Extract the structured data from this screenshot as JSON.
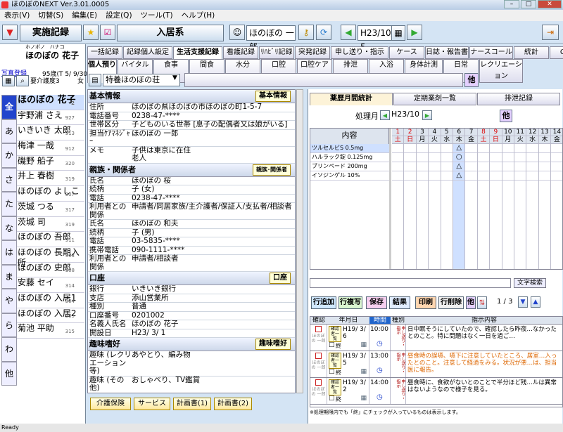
{
  "window": {
    "title": "ほのぼのNEXT  Ver.3.01.0005"
  },
  "menu": [
    "表示(V)",
    "切替(S)",
    "編集(E)",
    "設定(Q)",
    "ツール(T)",
    "ヘルプ(H)"
  ],
  "toolbar": {
    "mode_label": "実施記録",
    "category": "入居系",
    "user_name": "ほのぼの 一郎",
    "date": "H23/10/ 5"
  },
  "resident": {
    "ruby_family": "ホノボノ",
    "ruby_given": "ハナコ",
    "name": "ほのぼの 花子",
    "age_info": "95歳(T 5/ 9/30)",
    "care_level": "要介護度3",
    "sex": "女",
    "link_label": "写真登録"
  },
  "kana_tabs": [
    "全",
    "あ",
    "か",
    "さ",
    "た",
    "な",
    "は",
    "ま",
    "や",
    "ら",
    "わ",
    "他"
  ],
  "residents": [
    {
      "name": "ほのぼの 花子",
      "num": "2"
    },
    {
      "name": "宇野浦 さえ",
      "num": "927"
    },
    {
      "name": "いきいき 太郎",
      "num": "913"
    },
    {
      "name": "梅津 一哉",
      "num": "912"
    },
    {
      "name": "磯野 船子",
      "num": "320"
    },
    {
      "name": "井上 春樹",
      "num": "319"
    },
    {
      "name": "ほのぼの よしこ",
      "num": "907"
    },
    {
      "name": "茨城 つる",
      "num": "317"
    },
    {
      "name": "茨城 司",
      "num": "319"
    },
    {
      "name": "ほのぼの 吾郎",
      "num": "911"
    },
    {
      "name": "ほのぼの 長期入所",
      "num": "903"
    },
    {
      "name": "ほのぼの 史郎",
      "num": "908"
    },
    {
      "name": "安藤 セイ",
      "num": "314"
    },
    {
      "name": "ほのぼの 入居1",
      "num": "904"
    },
    {
      "name": "ほのぼの 入居2",
      "num": "905"
    },
    {
      "name": "菊池 平助",
      "num": "315"
    }
  ],
  "tabs_top": [
    "一括記録",
    "記録個人設定",
    "生活支援記録",
    "看護記録",
    "ﾘﾊﾋﾞﾘ記録",
    "突発記録",
    "申し送り・指示",
    "ケース",
    "日誌・報告書",
    "ナースコール",
    "統計",
    "CSV"
  ],
  "tabs_sub": [
    "個人預り",
    "バイタル",
    "食事",
    "間食",
    "水分",
    "口腔",
    "口腔ケア",
    "排泄",
    "入浴",
    "身体計測",
    "日常",
    "レクリエーション"
  ],
  "facility": "特養ほのぼの荘",
  "other_label": "他",
  "basic": {
    "title": "基本情報",
    "btn": "基本情報",
    "rows": [
      {
        "k": "住所",
        "v": "ほのぼの県ほのぼの市ほのぼの町1-5-7"
      },
      {
        "k": "電話番号",
        "v": "0238-47-****"
      },
      {
        "k": "世帯区分",
        "v": "子どものいる世帯 [息子の配偶者又は娘がいる]"
      },
      {
        "k": "担当ｹｱﾏﾈｼﾞｬｰ",
        "v": "ほのぼの 一郎"
      },
      {
        "k": "メモ",
        "v": "子供は東京に在住\n老人"
      }
    ]
  },
  "family": {
    "title": "親族・関係者",
    "btn": "親族･関係者",
    "rows": [
      {
        "k": "氏名",
        "v": "ほのぼの 桜"
      },
      {
        "k": "続柄",
        "v": "子 (女)"
      },
      {
        "k": "電話",
        "v": "0238-47-****"
      },
      {
        "k": "利用者との関係",
        "v": "申請者/同居家族/主介護者/保証人/支払者/相談者"
      },
      {
        "k": "氏名",
        "v": "ほのぼの 和夫"
      },
      {
        "k": "続柄",
        "v": "子 (男)"
      },
      {
        "k": "電話",
        "v": "03-5835-****"
      },
      {
        "k": "携帯電話",
        "v": "090-1111-****"
      },
      {
        "k": "利用者との関係",
        "v": "申請者/相談者"
      }
    ]
  },
  "bank": {
    "title": "口座",
    "btn": "口座",
    "rows": [
      {
        "k": "銀行",
        "v": "いきいき銀行"
      },
      {
        "k": "支店",
        "v": "添山営業所"
      },
      {
        "k": "種別",
        "v": "普通"
      },
      {
        "k": "口座番号",
        "v": "0201002"
      },
      {
        "k": "名義人氏名",
        "v": "ほのぼの 花子"
      },
      {
        "k": "開設日",
        "v": "H23/ 3/ 1"
      }
    ]
  },
  "hobby": {
    "title": "趣味嗜好",
    "btn": "趣味嗜好",
    "rows": [
      {
        "k": "趣味 (レクリエーション等)",
        "v": "あやとり、編み物"
      },
      {
        "k": "趣味 (その他)",
        "v": "おしゃべり、TV鑑賞"
      }
    ]
  },
  "bottom_buttons": [
    "介護保険",
    "サービス",
    "計画書(1)",
    "計画書(2)"
  ],
  "right_tabs": [
    "薬歴月間統計",
    "定期業剤一覧",
    "排泄記録"
  ],
  "processing": {
    "label": "処理月",
    "month": "H23/10"
  },
  "med_table": {
    "header": "内容",
    "days": [
      "1",
      "2",
      "3",
      "4",
      "5",
      "6",
      "7",
      "8",
      "9",
      "10",
      "11",
      "12",
      "13",
      "14"
    ],
    "weekdays": [
      "土",
      "日",
      "月",
      "火",
      "水",
      "木",
      "金",
      "土",
      "日",
      "月",
      "火",
      "水",
      "木",
      "金"
    ],
    "items": [
      "ツルセルビS 0.5mg",
      "ハルラック錠 0.125mg",
      "ブリンペード 200mg",
      "イソジンゲル 10%"
    ],
    "marks": [
      "△",
      "○",
      "△",
      "△"
    ]
  },
  "search_btn": "文字検索",
  "action_buttons": [
    "行追加",
    "行複写",
    "保存",
    "結果",
    "印刷",
    "行削除",
    "他"
  ],
  "paging": "1 / 3",
  "instr_header": {
    "confirm": "確認",
    "date": "年月日",
    "time": "時間",
    "type": "種別",
    "text": "指示内容"
  },
  "instructions": [
    {
      "person": "ほのぼの 一郎",
      "date": "H19/ 3/ 6",
      "time": "10:00",
      "type": "申し送り・指示",
      "text": "日中眠そうにしていたので、確認したら昨夜…なかったとのこと。特に問題はなく一日を過ご…",
      "end": "終",
      "list_btn": "確認者一覧"
    },
    {
      "person": "ほのぼの 一郎",
      "date": "H19/ 3/ 5",
      "time": "13:00",
      "type": "申し送り・指示",
      "text": "昼食時の誤嚥、嚥下に注意していたところ、居室…入ったとのこと。注意して経過をみる。状況が悪…は、担当医に報告。",
      "end": "終",
      "list_btn": "確認者一覧"
    },
    {
      "person": "ほのぼの 一郎",
      "date": "H19/ 3/ 2",
      "time": "14:00",
      "type": "申し送り・指示",
      "text": "昼食時に、食欲がないとのことで半分ほど残…ルは異常はないようなので様子を見る。",
      "end": "終",
      "list_btn": "確認者一覧"
    }
  ],
  "footnote": "※処理期限内でも「終」にチェックが入っているものは表示します。",
  "status": "Ready"
}
